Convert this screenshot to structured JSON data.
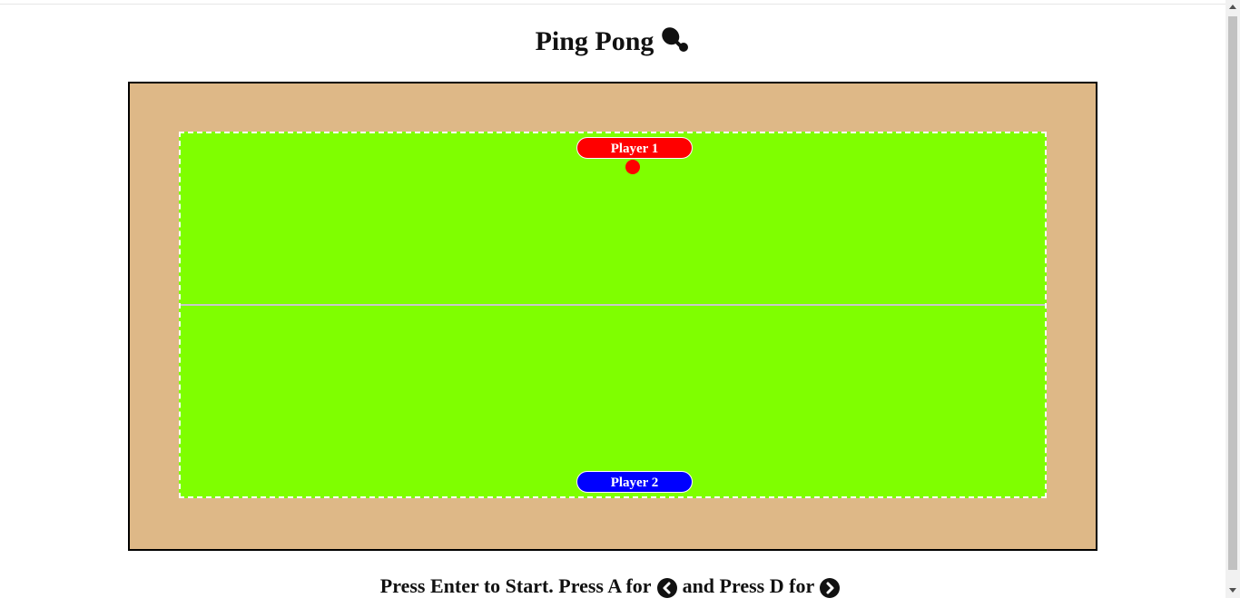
{
  "header": {
    "title": "Ping Pong",
    "icon": "ping-pong-paddle-icon"
  },
  "game": {
    "player1_label": "Player 1",
    "player2_label": "Player 2",
    "colors": {
      "board": "#deb887",
      "table": "#7fff00",
      "player1": "#ff0000",
      "player2": "#0000ff",
      "ball": "#ff0000"
    }
  },
  "instructions": {
    "part1": "Press Enter to Start. Press A for",
    "left_icon": "chevron-left-circle-icon",
    "part2": "and Press D for",
    "right_icon": "chevron-right-circle-icon"
  }
}
